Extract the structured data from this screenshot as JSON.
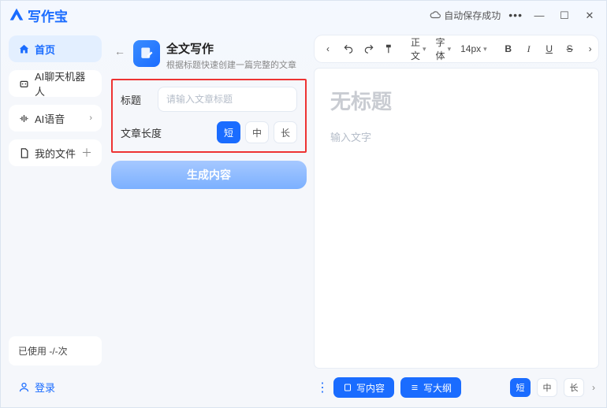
{
  "app": {
    "name": "写作宝",
    "autosave": "自动保存成功"
  },
  "sidebar": {
    "items": [
      {
        "label": "首页",
        "icon": "home"
      },
      {
        "label": "AI聊天机器人",
        "icon": "robot"
      },
      {
        "label": "AI语音",
        "icon": "wave"
      },
      {
        "label": "我的文件",
        "icon": "file"
      }
    ],
    "usage_prefix": "已使用 ",
    "usage_value": "-/-",
    "usage_suffix": "次",
    "login": "登录"
  },
  "center": {
    "feature_title": "全文写作",
    "feature_desc": "根据标题快速创建一篇完整的文章",
    "field_title_label": "标题",
    "field_title_placeholder": "请输入文章标题",
    "field_length_label": "文章长度",
    "length_options": [
      "短",
      "中",
      "长"
    ],
    "selected_length": "短",
    "generate": "生成内容"
  },
  "toolbar": {
    "paragraph": "正文",
    "font": "字体",
    "fontsize": "14px"
  },
  "editor": {
    "title_placeholder": "无标题",
    "body_placeholder": "输入文字"
  },
  "bottombar": {
    "write_content": "写内容",
    "write_outline": "写大纲",
    "length_options": [
      "短",
      "中",
      "长"
    ],
    "selected_length": "短"
  }
}
